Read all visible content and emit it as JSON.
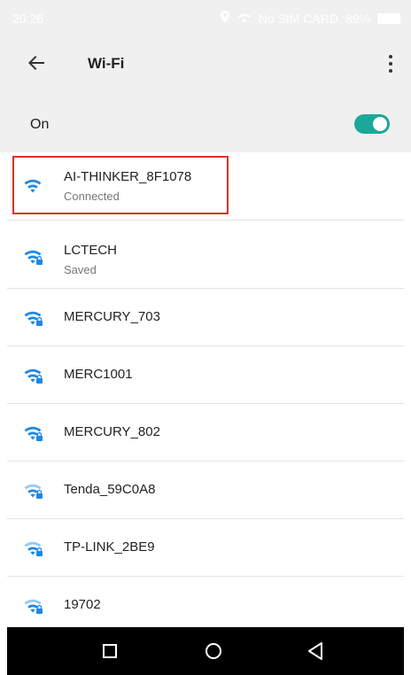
{
  "status_bar": {
    "time": "20:26",
    "sim_status": "No SIM CARD",
    "battery": "89%"
  },
  "app_bar": {
    "title": "Wi-Fi"
  },
  "toggle_row": {
    "label": "On",
    "state": "on",
    "accent_color": "#1aa89a"
  },
  "networks": [
    {
      "ssid": "AI-THINKER_8F1078",
      "status": "Connected",
      "signal": "full",
      "locked": false
    },
    {
      "ssid": "LCTECH",
      "status": "Saved",
      "signal": "full",
      "locked": true
    },
    {
      "ssid": "MERCURY_703",
      "status": "",
      "signal": "full",
      "locked": true
    },
    {
      "ssid": "MERC1001",
      "status": "",
      "signal": "full",
      "locked": true
    },
    {
      "ssid": "MERCURY_802",
      "status": "",
      "signal": "full",
      "locked": true
    },
    {
      "ssid": "Tenda_59C0A8",
      "status": "",
      "signal": "medium",
      "locked": true
    },
    {
      "ssid": "TP-LINK_2BE9",
      "status": "",
      "signal": "medium",
      "locked": true
    },
    {
      "ssid": "19702",
      "status": "",
      "signal": "medium",
      "locked": true
    }
  ],
  "colors": {
    "wifi_icon": "#1e88e5",
    "wifi_icon_weak": "#90caf9",
    "highlight_box": "#d9342b"
  }
}
